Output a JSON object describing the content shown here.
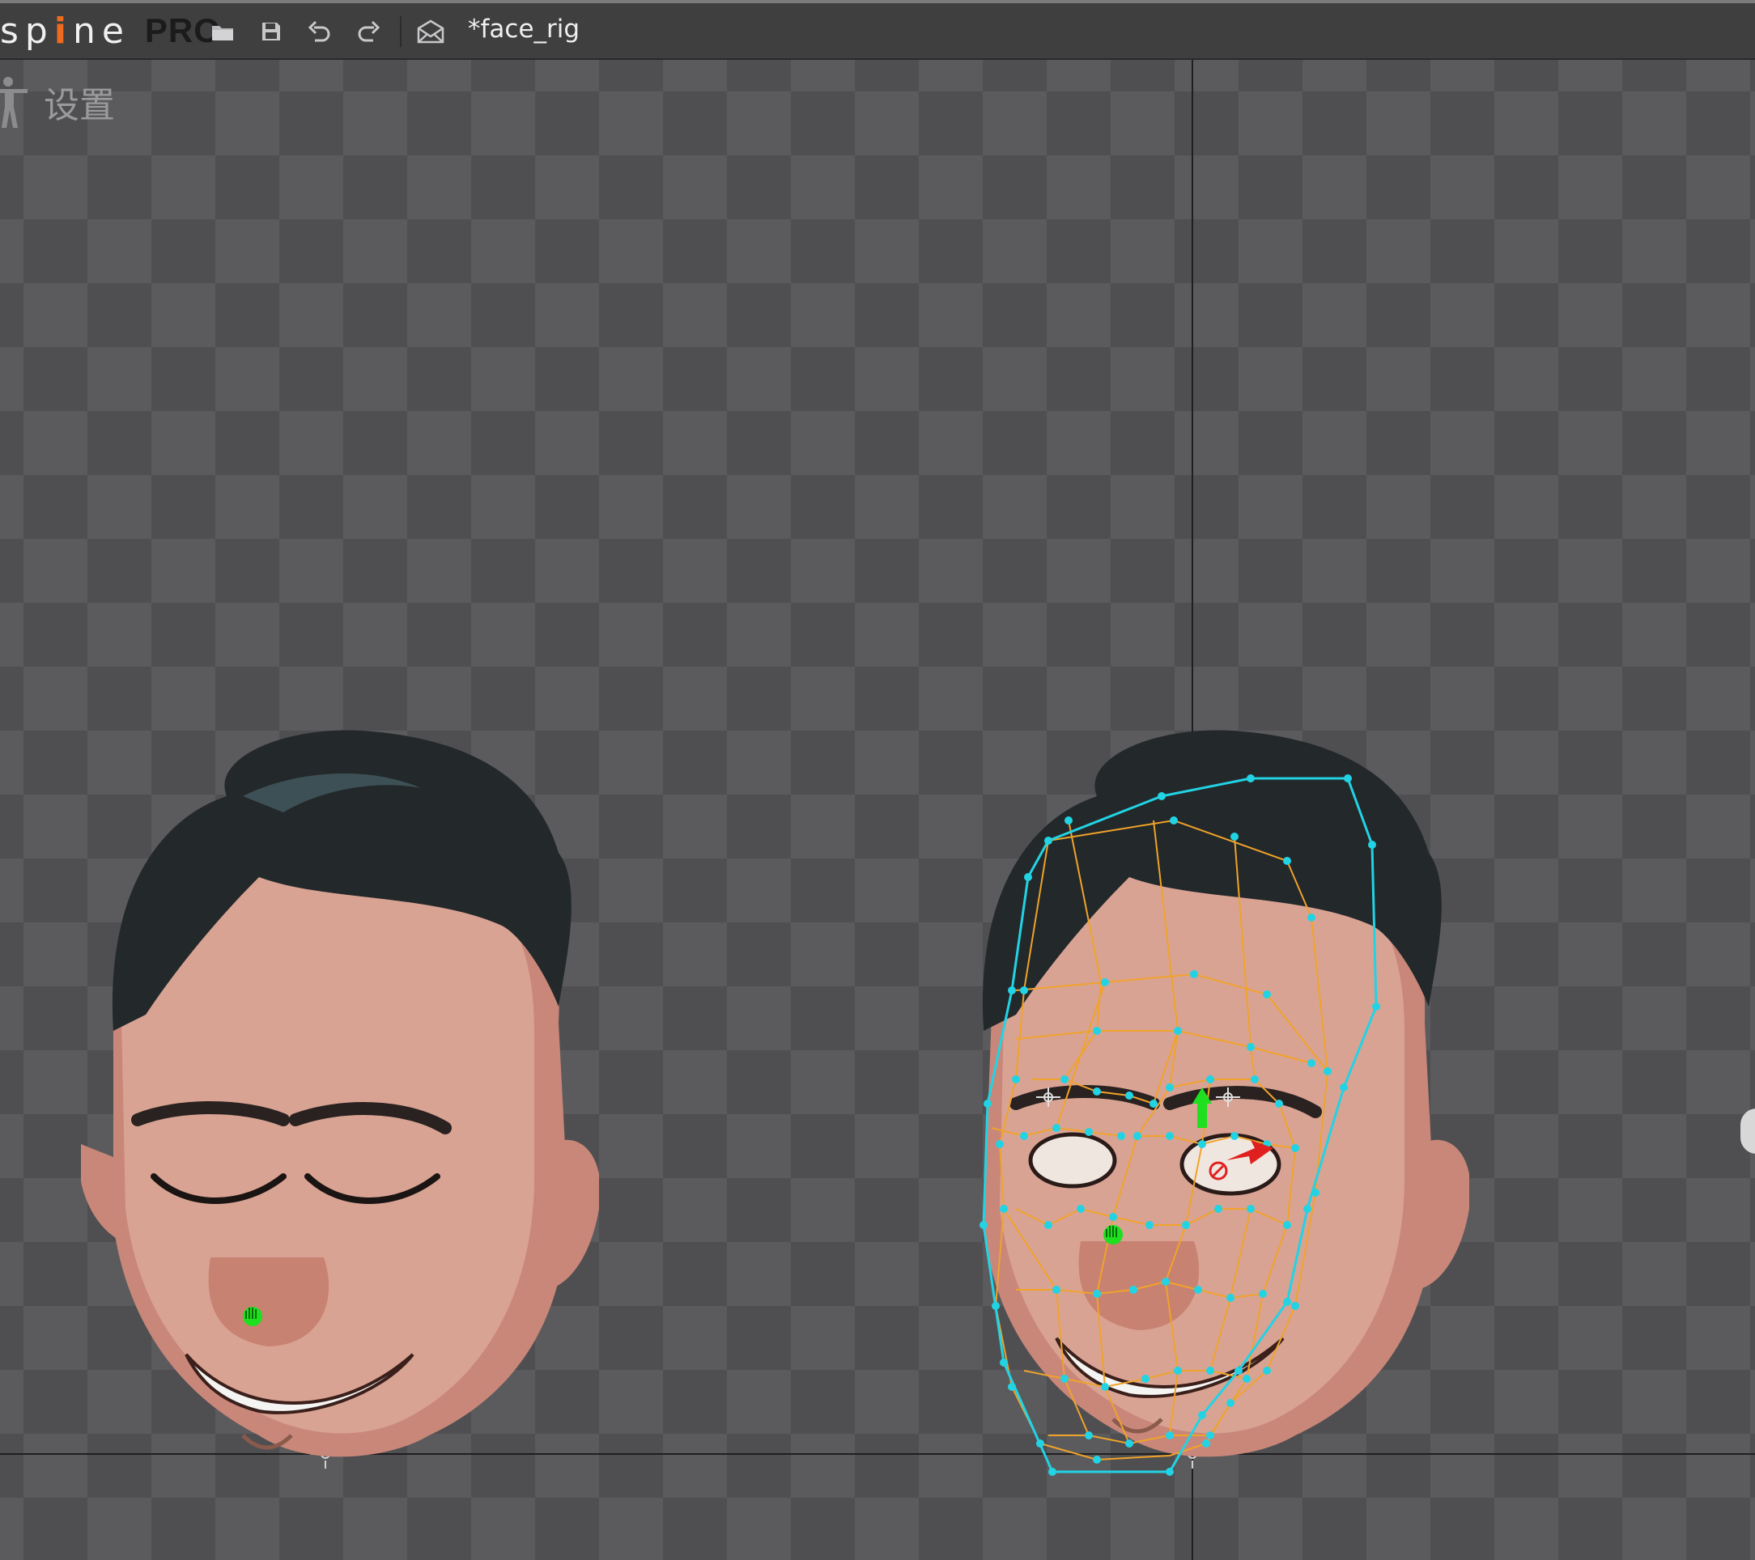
{
  "app": {
    "logo_text_start": "sp",
    "logo_text_i": "i",
    "logo_text_end": "ne",
    "logo_edition": "PRO"
  },
  "toolbar": {
    "items": [
      "open-folder-icon",
      "save-icon",
      "undo-icon",
      "redo-icon",
      "send-icon"
    ]
  },
  "document": {
    "title": "*face_rig"
  },
  "viewport": {
    "mode_label": "设置",
    "mode_icon": "skeleton-icon"
  },
  "colors": {
    "mesh_hull": "#22d3e4",
    "mesh_edges": "#f0a32a",
    "mesh_vertex": "#22d3e4",
    "bone_green": "#1ee01e",
    "ik_red": "#e0201f",
    "logo_orange": "#ee6a1f"
  }
}
